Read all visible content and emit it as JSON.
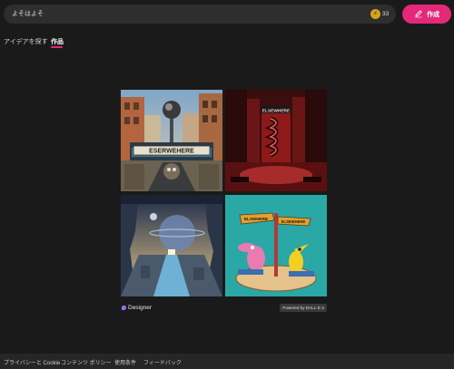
{
  "search": {
    "value": "よそはよそ"
  },
  "credits": {
    "coin_icon": "coin-icon",
    "count": "33"
  },
  "create_button": {
    "label": "作成",
    "icon": "pen-icon",
    "color": "#e4287a"
  },
  "tabs": [
    {
      "label": "アイデアを探す",
      "active": false
    },
    {
      "label": "作品",
      "active": true
    }
  ],
  "gallery": {
    "images": [
      {
        "sign_text": "ESERWEHERE"
      },
      {
        "sign_text": "ELSEWHERE"
      },
      {
        "sign_text": ""
      },
      {
        "sign_text_left": "ELSWHERE",
        "sign_text_right": "ELSEWHERE"
      }
    ]
  },
  "designer": {
    "label": "Designer",
    "icon": "designer-icon"
  },
  "powered_by": "Powered by DALL·E 3",
  "footer": {
    "links": [
      "プライバシーと Cookie",
      "コンテンツ ポリシー",
      "使用条件",
      "フィードバック"
    ]
  }
}
